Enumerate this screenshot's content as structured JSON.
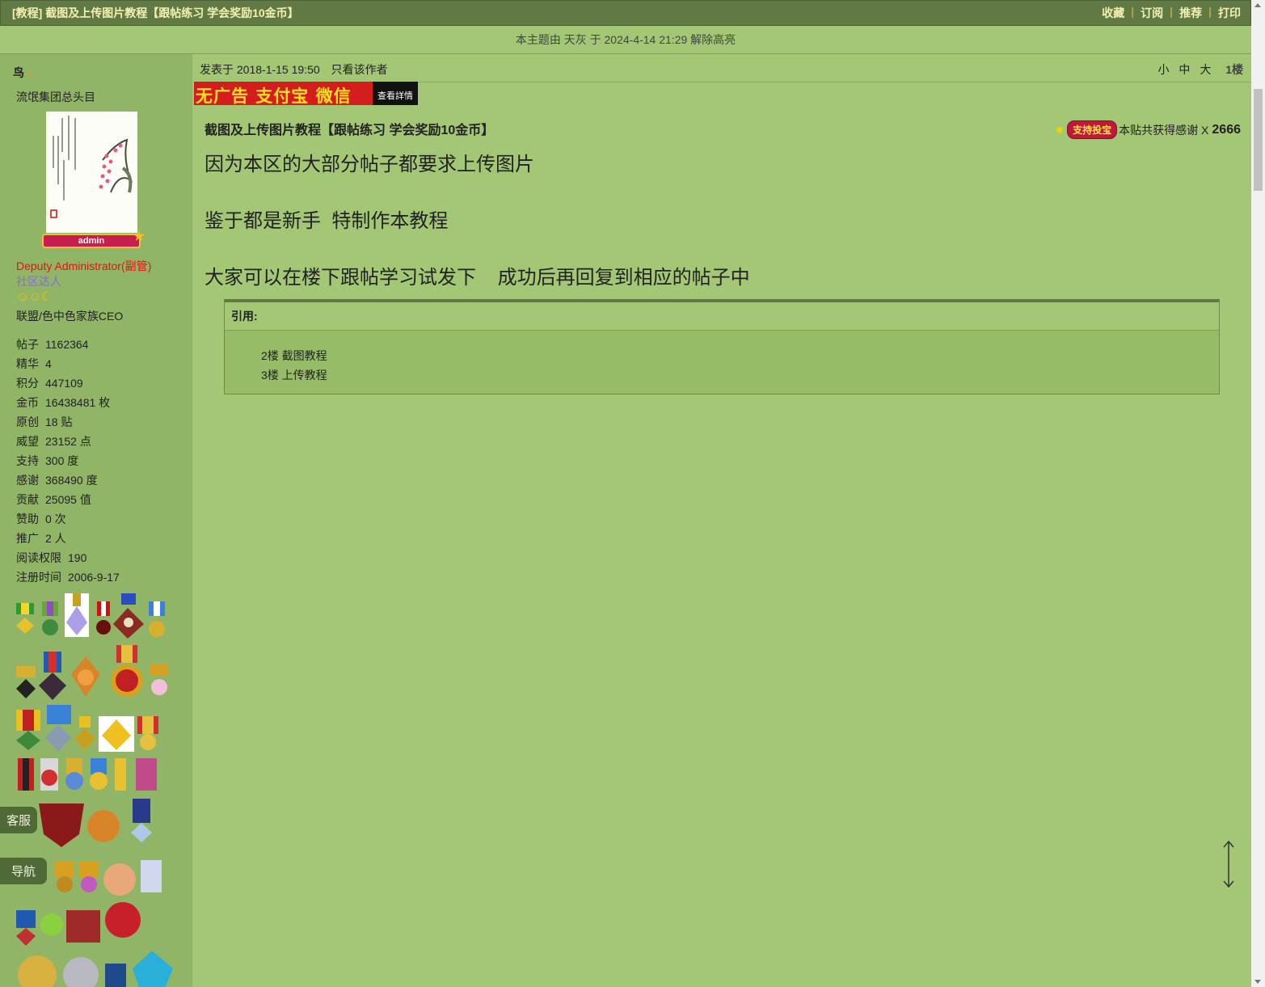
{
  "titlebar": {
    "title": "[教程] 截图及上传图片教程【跟帖练习 学会奖励10金币】",
    "actions": [
      "收藏",
      "订阅",
      "推荐",
      "打印"
    ]
  },
  "notice": "本主题由 天灰 于 2024-4-14 21:29 解除高亮",
  "user": {
    "name": "鸟",
    "title": "流氓集团总头目",
    "badge": "admin",
    "group": "Deputy Administrator(副管)",
    "rank": "社区达人",
    "family": "联盟/色中色家族CEO",
    "stats": [
      {
        "k": "帖子",
        "v": "1162364"
      },
      {
        "k": "精华",
        "v": "4"
      },
      {
        "k": "积分",
        "v": "447109"
      },
      {
        "k": "金币",
        "v": "16438481 枚"
      },
      {
        "k": "原创",
        "v": "18 贴"
      },
      {
        "k": "威望",
        "v": "23152 点"
      },
      {
        "k": "支持",
        "v": "300 度"
      },
      {
        "k": "感谢",
        "v": "368490 度"
      },
      {
        "k": "贡献",
        "v": "25095 值"
      },
      {
        "k": "赞助",
        "v": "0 次"
      },
      {
        "k": "推广",
        "v": "2 人"
      },
      {
        "k": "阅读权限",
        "v": "190"
      },
      {
        "k": "注册时间",
        "v": "2006-9-17"
      }
    ]
  },
  "float_buttons": {
    "service": "客服",
    "nav": "导航"
  },
  "post": {
    "time": "发表于 2018-1-15 19:50",
    "only_author": "只看该作者",
    "font_small": "小",
    "font_mid": "中",
    "font_big": "大",
    "floor": "1楼",
    "ad_text": "无广告 支付宝 微信",
    "ad_more": "查看詳情",
    "subject": "截图及上传图片教程【跟帖练习 学会奖励10金币】",
    "support_label": "支持投宝",
    "thanks_text": "本贴共获得感谢 X",
    "thanks_count": "2666",
    "lines": [
      "因为本区的大部分帖子都要求上传图片",
      "鉴于都是新手  特制作本教程",
      "大家可以在楼下跟帖学习试发下    成功后再回复到相应的帖子中"
    ],
    "quote": {
      "label": "引用:",
      "lines": [
        "2楼   截图教程",
        "3楼   上传教程"
      ]
    }
  },
  "colors": {
    "page_bg": "#a3c774",
    "sidebar_bg": "#91b566",
    "titlebar_bg": "#617a45",
    "group_red": "#e8110f",
    "rank_purple": "#8a6ad0"
  }
}
